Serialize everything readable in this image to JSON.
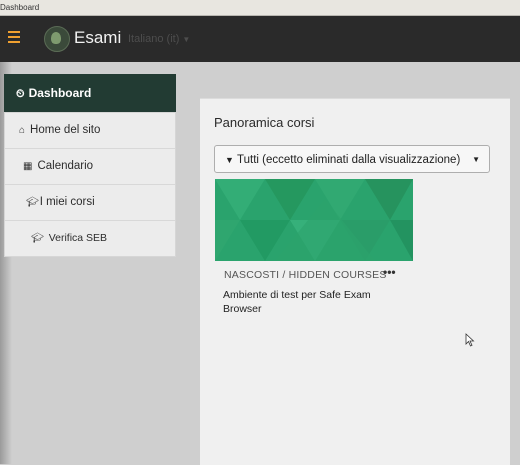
{
  "tab": {
    "title": "Dashboard"
  },
  "navbar": {
    "menu_icon": "hamburger-icon",
    "logo_icon": "site-logo",
    "brand": "Esami",
    "language": "Italiano (it)",
    "accent_color": "#f0a030"
  },
  "sidebar": {
    "active": {
      "icon": "tachometer-icon",
      "label": "Dashboard"
    },
    "items": [
      {
        "icon": "home-icon",
        "label": "Home del sito"
      },
      {
        "icon": "calendar-icon",
        "label": "Calendario"
      },
      {
        "icon": "graduation-cap-icon",
        "label": "I miei corsi"
      },
      {
        "icon": "graduation-cap-icon",
        "label": "Verifica SEB"
      }
    ],
    "active_color": "#223b33"
  },
  "main": {
    "title": "Panoramica corsi",
    "filter": {
      "icon": "filter-icon",
      "selected": "Tutti (eccetto eliminati dalla visualizzazione)"
    },
    "course": {
      "category": "NASCOSTI / HIDDEN COURSES",
      "name": "Ambiente di test per Safe Exam Browser",
      "more_label": "•••",
      "image_color": "#2aa36d"
    }
  }
}
